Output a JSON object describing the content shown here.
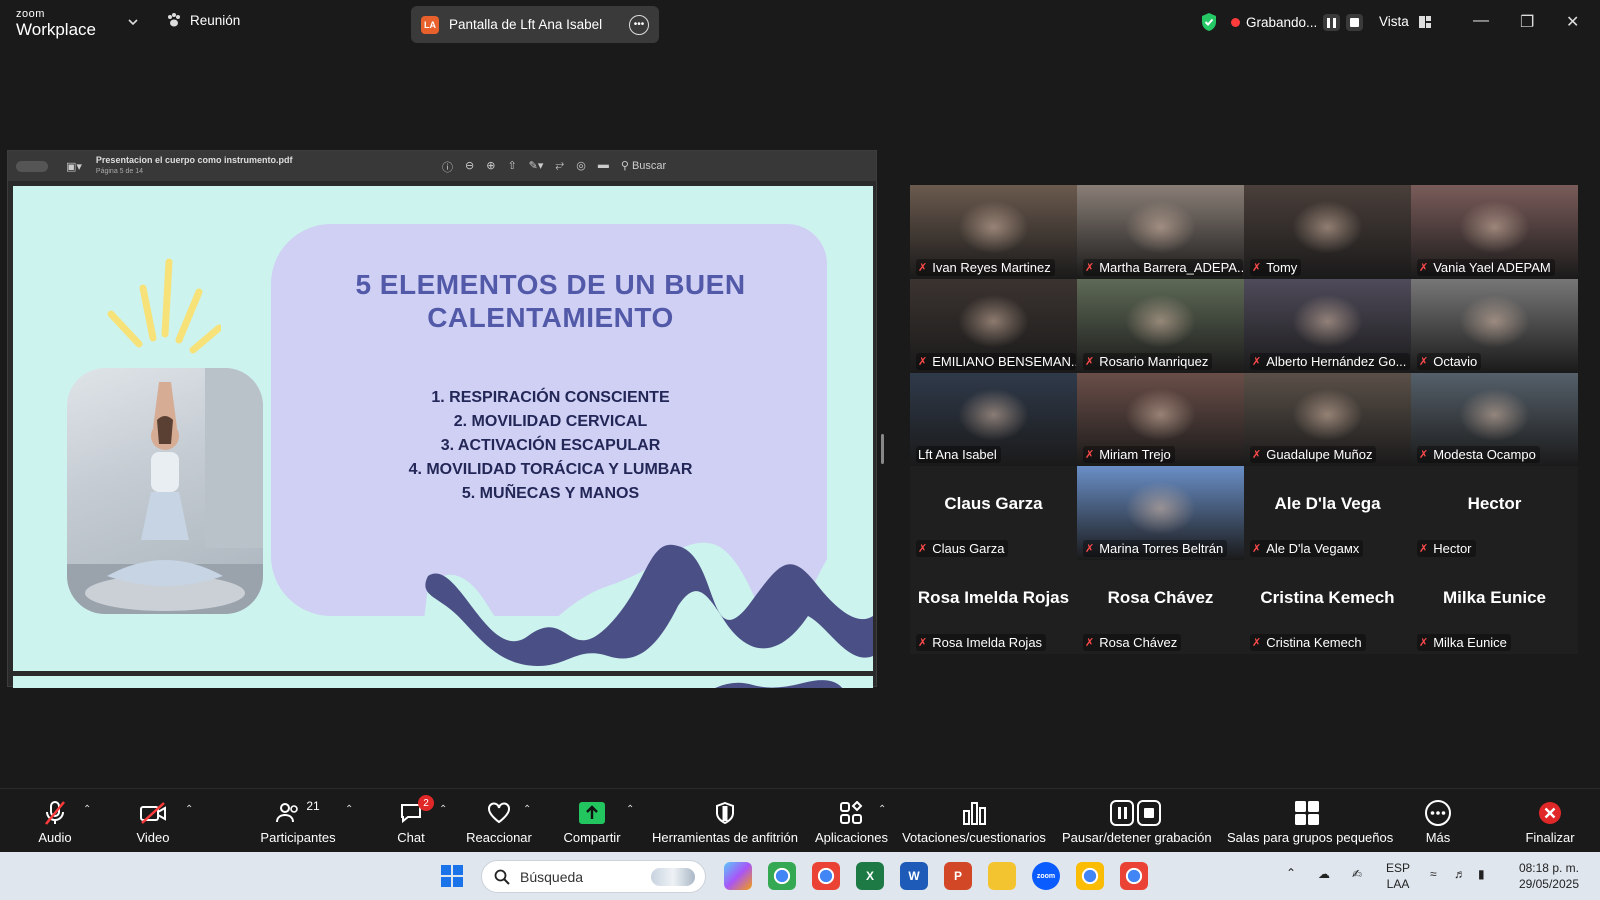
{
  "app": {
    "brand_top": "zoom",
    "brand_bottom": "Workplace",
    "meeting_label": "Reunión"
  },
  "share": {
    "badge": "LA",
    "label": "Pantalla de Lft Ana Isabel"
  },
  "recording": {
    "status": "Grabando..."
  },
  "view": {
    "label": "Vista"
  },
  "pdf": {
    "filename": "Presentacion el cuerpo como instrumento.pdf",
    "page": "Página 5 de 14",
    "search_placeholder": "Buscar"
  },
  "slide": {
    "title": "5 ELEMENTOS DE UN BUEN CALENTAMIENTO",
    "items": [
      "1. RESPIRACIÓN CONSCIENTE",
      "2. MOVILIDAD CERVICAL",
      "3. ACTIVACIÓN ESCAPULAR",
      "4. MOVILIDAD TORÁCICA Y LUMBAR",
      "5. MUÑECAS Y MANOS"
    ]
  },
  "participants": [
    {
      "name": "Ivan Reyes Martinez",
      "video": true
    },
    {
      "name": "Martha Barrera_ADEPA...",
      "video": true
    },
    {
      "name": "Tomy",
      "video": true
    },
    {
      "name": "Vania Yael  ADEPAM",
      "video": true
    },
    {
      "name": "EMILIANO BENSEMAN...",
      "video": true
    },
    {
      "name": "Rosario Manriquez",
      "video": true
    },
    {
      "name": "Alberto Hernández Go...",
      "video": true
    },
    {
      "name": "Octavio",
      "video": true
    },
    {
      "name": "Lft Ana Isabel",
      "video": true,
      "active": true
    },
    {
      "name": "Miriam Trejo",
      "video": true
    },
    {
      "name": "Guadalupe Muñoz",
      "video": true
    },
    {
      "name": "Modesta Ocampo",
      "video": true
    },
    {
      "name": "Claus Garza",
      "big": "Claus Garza"
    },
    {
      "name": "Marina Torres Beltrán",
      "video": true
    },
    {
      "name": "Ale D'la Vegaмх",
      "big": "Ale D'la Vega"
    },
    {
      "name": "Hector",
      "big": "Hector"
    },
    {
      "name": "Rosa Imelda Rojas",
      "big": "Rosa Imelda Rojas"
    },
    {
      "name": "Rosa Chávez",
      "big": "Rosa Chávez"
    },
    {
      "name": "Cristina Kemech",
      "big": "Cristina Kemech"
    },
    {
      "name": "Milka Eunice",
      "big": "Milka Eunice"
    }
  ],
  "toolbar": {
    "audio": "Audio",
    "video": "Video",
    "participants": "Participantes",
    "participants_count": "21",
    "chat": "Chat",
    "chat_badge": "2",
    "react": "Reaccionar",
    "share": "Compartir",
    "host_tools": "Herramientas de anfitrión",
    "apps": "Aplicaciones",
    "polls": "Votaciones/cuestionarios",
    "pause_rec": "Pausar/detener grabación",
    "breakout": "Salas para grupos pequeños",
    "more": "Más",
    "end": "Finalizar"
  },
  "taskbar": {
    "search": "Búsqueda",
    "lang1": "ESP",
    "lang2": "LAA",
    "time": "08:18 p. m.",
    "date": "29/05/2025"
  },
  "colors": {
    "accent_green": "#24c864",
    "rec_red": "#ff3b3b",
    "share_green": "#22c55e",
    "end_red": "#e02828",
    "slide_title": "#5259a8",
    "slide_bg": "#cdf3ee",
    "slide_panel": "#cfd0f3"
  }
}
